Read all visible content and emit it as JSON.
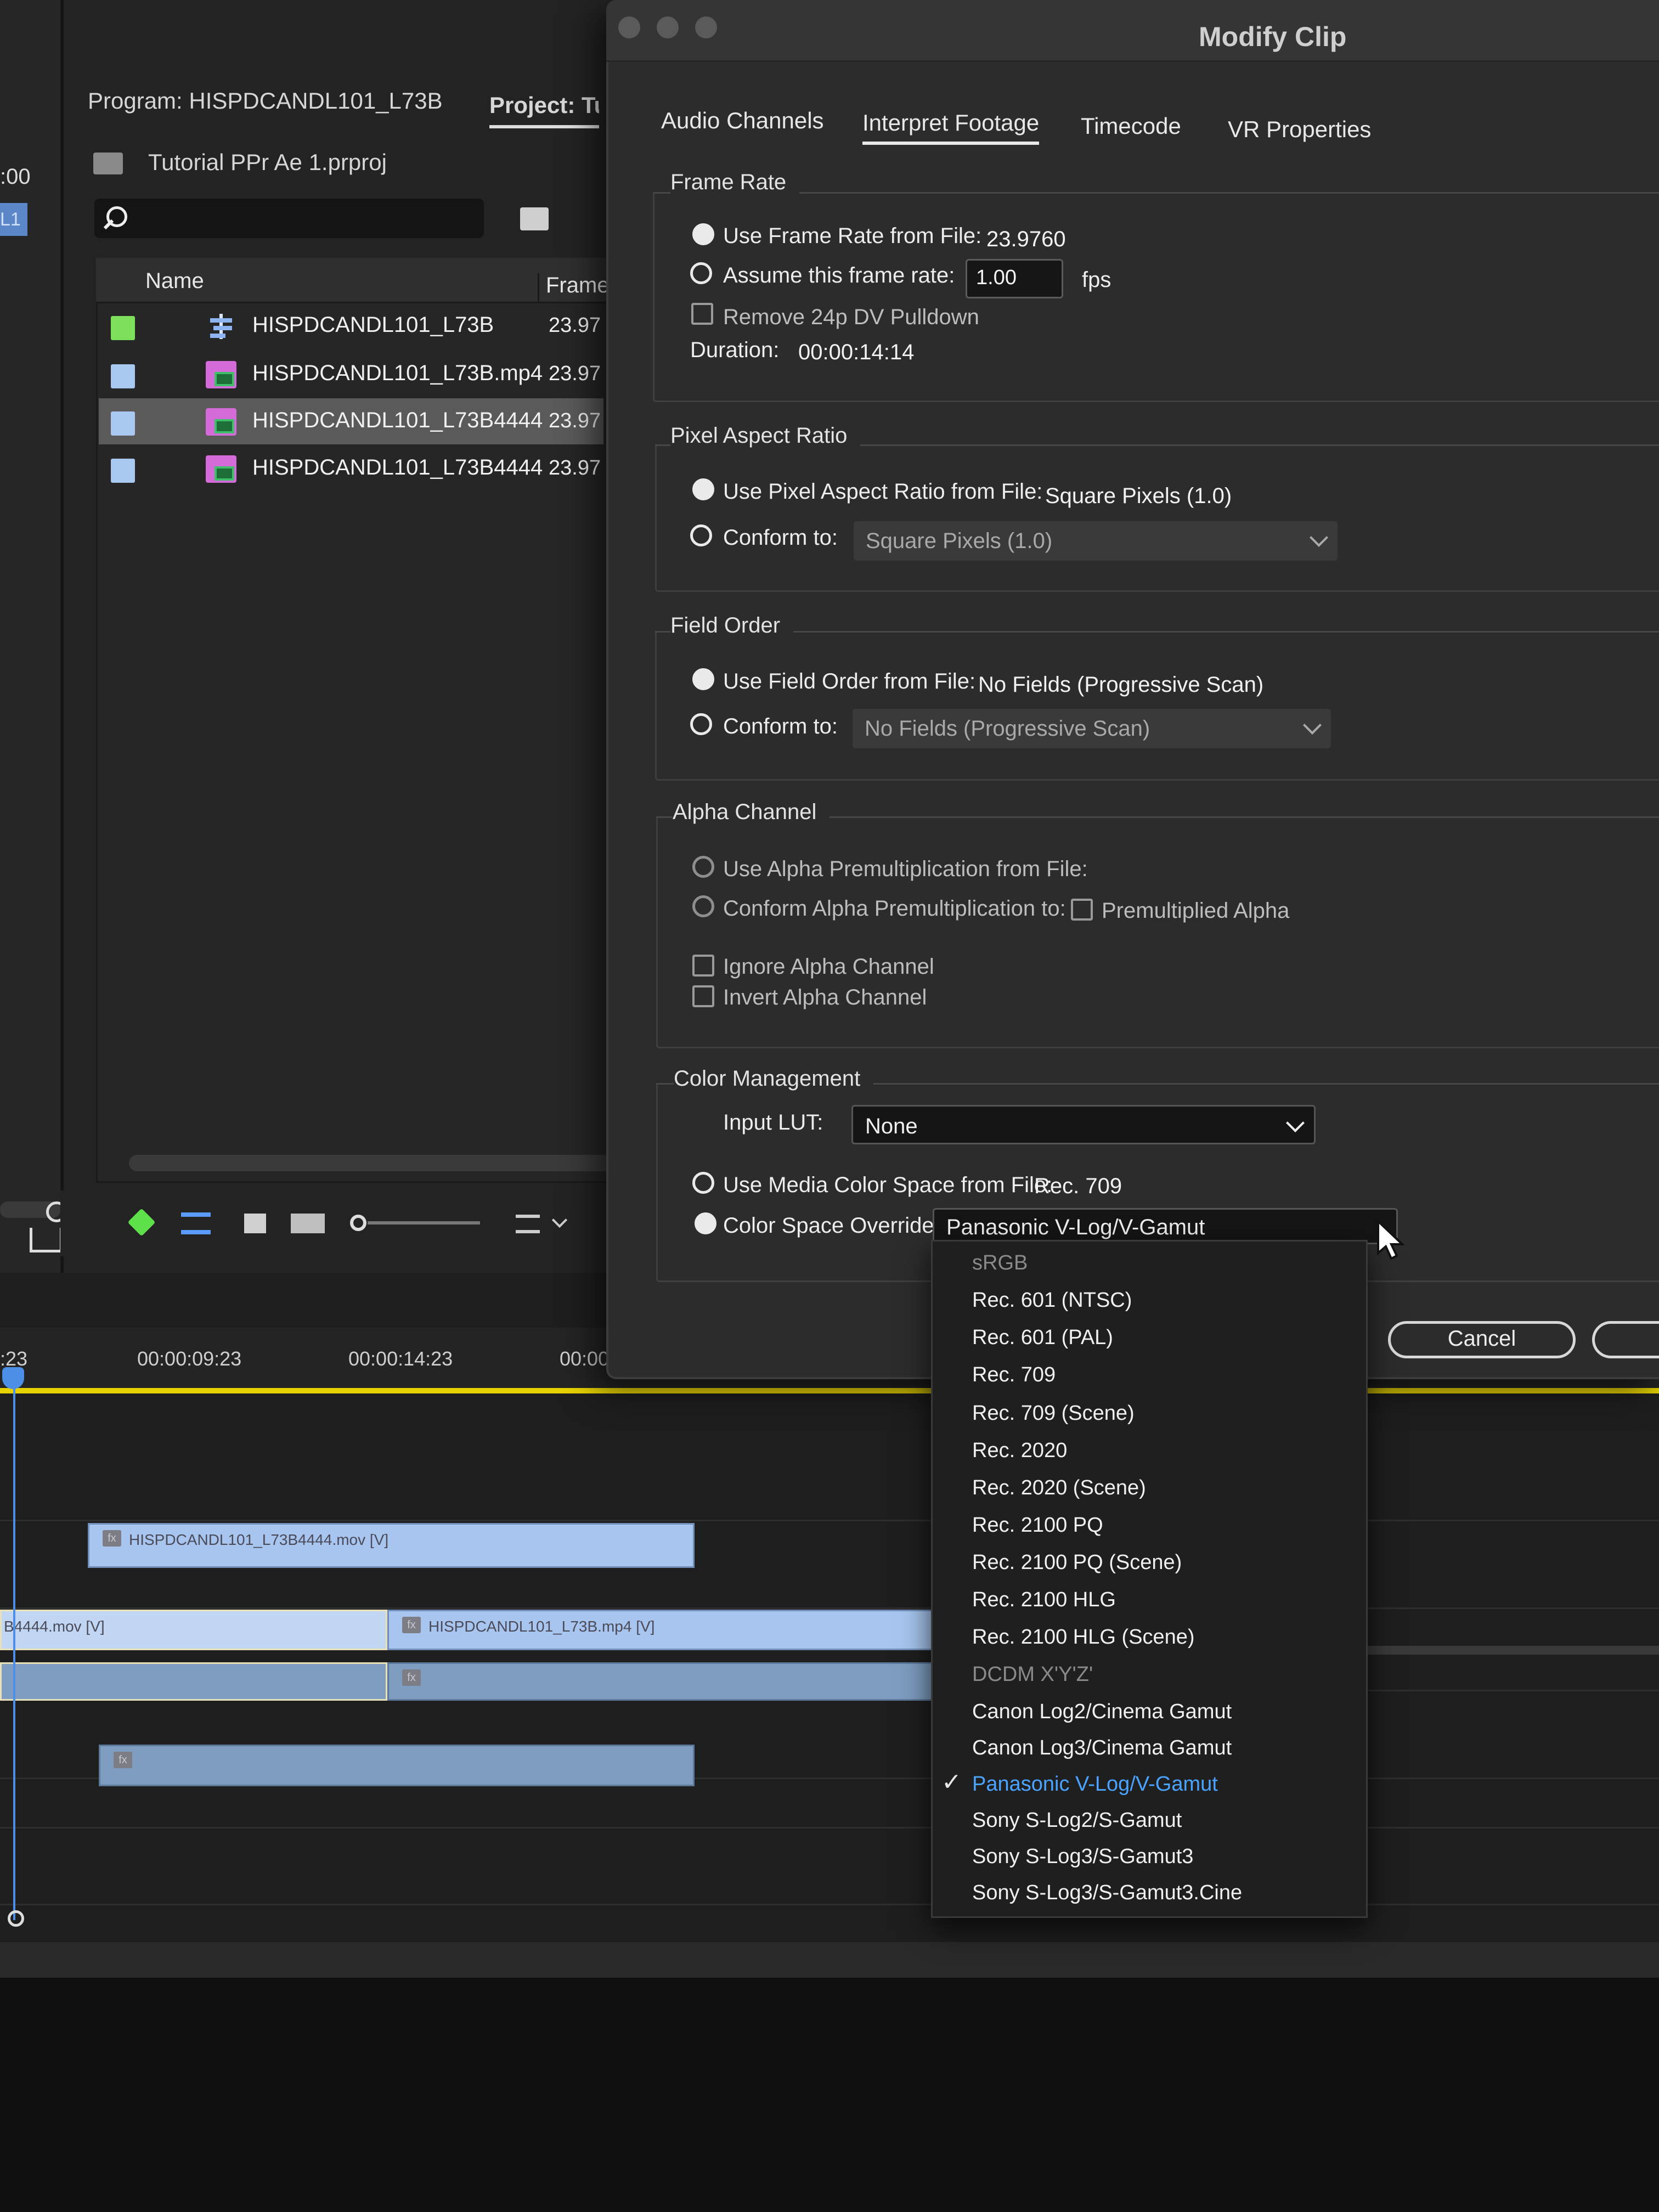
{
  "app": {
    "program_label": "Program: HISPDCANDL101_L73B",
    "project_tab": "Project: Tut",
    "left_tc": ":00",
    "left_chip": "L1",
    "project_file": "Tutorial PPr Ae 1.prproj",
    "columns": {
      "name": "Name",
      "frame": "Frame"
    },
    "rows": [
      {
        "name": "HISPDCANDL101_L73B",
        "frame": "23.97",
        "chip_color": "#7ee05a",
        "icon": "sequence-icon"
      },
      {
        "name": "HISPDCANDL101_L73B.mp4",
        "frame": "23.97",
        "chip_color": "#a9c8f0",
        "icon": "clip-icon"
      },
      {
        "name": "HISPDCANDL101_L73B4444",
        "frame": "23.97",
        "chip_color": "#a9c8f0",
        "icon": "clip-icon",
        "selected": true
      },
      {
        "name": "HISPDCANDL101_L73B4444",
        "frame": "23.97",
        "chip_color": "#a9c8f0",
        "icon": "clip-icon"
      }
    ]
  },
  "timeline": {
    "ticks": [
      ":23",
      "00:00:09:23",
      "00:00:14:23",
      "00:00"
    ],
    "clips": {
      "v_top": "HISPDCANDL101_L73B4444.mov [V]",
      "v_left": "B4444.mov [V]",
      "v_right": "HISPDCANDL101_L73B.mp4 [V]",
      "fx": "fx"
    }
  },
  "dialog": {
    "title": "Modify Clip",
    "tabs": [
      "Audio Channels",
      "Interpret Footage",
      "Timecode",
      "VR Properties"
    ],
    "frame_rate": {
      "title": "Frame Rate",
      "use_from_file": "Use Frame Rate from File:",
      "file_value": "23.9760",
      "assume": "Assume this frame rate:",
      "assume_value": "1.00",
      "fps": "fps",
      "pulldown": "Remove 24p DV Pulldown",
      "duration_label": "Duration:",
      "duration_value": "00:00:14:14"
    },
    "par": {
      "title": "Pixel Aspect Ratio",
      "use_from_file": "Use Pixel Aspect Ratio from File:",
      "file_value": "Square Pixels (1.0)",
      "conform": "Conform to:",
      "conform_value": "Square Pixels (1.0)"
    },
    "field_order": {
      "title": "Field Order",
      "use_from_file": "Use Field Order from File:",
      "file_value": "No Fields (Progressive Scan)",
      "conform": "Conform to:",
      "conform_value": "No Fields (Progressive Scan)"
    },
    "alpha": {
      "title": "Alpha Channel",
      "use_premult": "Use Alpha Premultiplication from File:",
      "conform_premult": "Conform Alpha Premultiplication to:",
      "premult_alpha": "Premultiplied Alpha",
      "ignore": "Ignore Alpha Channel",
      "invert": "Invert Alpha Channel"
    },
    "color": {
      "title": "Color Management",
      "input_lut": "Input LUT:",
      "input_lut_value": "None",
      "use_media": "Use Media Color Space from File:",
      "media_value": "Rec. 709",
      "override": "Color Space Override:",
      "override_value": "Panasonic V-Log/V-Gamut"
    },
    "cancel": "Cancel"
  },
  "menu": {
    "items": [
      {
        "label": "sRGB",
        "state": "disabled"
      },
      {
        "label": "Rec. 601 (NTSC)",
        "state": "normal"
      },
      {
        "label": "Rec. 601 (PAL)",
        "state": "normal"
      },
      {
        "label": "Rec. 709",
        "state": "normal"
      },
      {
        "label": "Rec. 709 (Scene)",
        "state": "normal"
      },
      {
        "label": "Rec. 2020",
        "state": "normal"
      },
      {
        "label": "Rec. 2020 (Scene)",
        "state": "normal"
      },
      {
        "label": "Rec. 2100 PQ",
        "state": "normal"
      },
      {
        "label": "Rec. 2100 PQ (Scene)",
        "state": "normal"
      },
      {
        "label": "Rec. 2100 HLG",
        "state": "normal"
      },
      {
        "label": "Rec. 2100 HLG (Scene)",
        "state": "normal"
      },
      {
        "label": "DCDM X'Y'Z'",
        "state": "disabled"
      },
      {
        "label": "Canon Log2/Cinema Gamut",
        "state": "normal"
      },
      {
        "label": "Canon Log3/Cinema Gamut",
        "state": "normal"
      },
      {
        "label": "Panasonic V-Log/V-Gamut",
        "state": "checked"
      },
      {
        "label": "Sony S-Log2/S-Gamut",
        "state": "normal"
      },
      {
        "label": "Sony S-Log3/S-Gamut3",
        "state": "normal"
      },
      {
        "label": "Sony S-Log3/S-Gamut3.Cine",
        "state": "normal"
      }
    ],
    "check_glyph": "✓",
    "colors": {
      "checked": "#4aa3ff",
      "disabled": "#8a8a8a"
    }
  }
}
